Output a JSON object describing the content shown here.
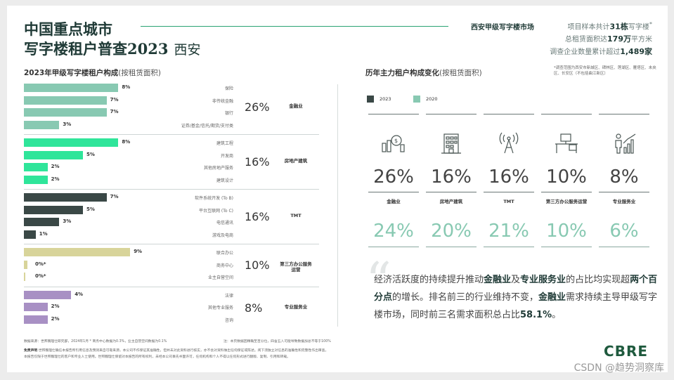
{
  "header": {
    "title_line1": "中国重点城市",
    "title_line2": "写字楼租户普查2023",
    "city": "西安",
    "market_label": "西安甲级写字楼市场",
    "stat1_pre": "项目样本共计",
    "stat1_val": "31栋",
    "stat1_post": "写字楼",
    "stat2_pre": "总租赁面积达",
    "stat2_val": "179万",
    "stat2_post": "平方米",
    "stat3_pre": "调查企业数量累计超过",
    "stat3_val": "1,489家",
    "footnote_mark": "*",
    "scope_note": "*调查范围为西安市新城区、碑林区、莲湖区、雁塔区、未央区、长安区（不包括曲江新区）"
  },
  "left": {
    "title": "2023年甲级写字楼租户构成",
    "title_sub": "(按租赁面积)"
  },
  "right": {
    "title": "历年主力租户构成变化",
    "title_sub": "(按租赁面积)",
    "legend": [
      {
        "label": "2023",
        "color": "#3a4846"
      },
      {
        "label": "2020",
        "color": "#88c9b2"
      }
    ]
  },
  "chart_data": [
    {
      "type": "bar",
      "orientation": "horizontal",
      "title": "2023年甲级写字楼租户构成(按租赁面积)",
      "groups": [
        {
          "name": "金融业",
          "total": "26%",
          "color": "#88c9b2",
          "items": [
            {
              "label": "保险",
              "value": 8
            },
            {
              "label": "非传统金融",
              "value": 7
            },
            {
              "label": "银行",
              "value": 7
            },
            {
              "label": "证券/基金/信托/期货/支付类",
              "value": 3
            }
          ]
        },
        {
          "name": "房地产建筑",
          "total": "16%",
          "color": "#2fe59a",
          "items": [
            {
              "label": "建筑工程",
              "value": 8
            },
            {
              "label": "开发商",
              "value": 5
            },
            {
              "label": "其他房地产服务",
              "value": 2
            },
            {
              "label": "建筑设计",
              "value": 2
            }
          ]
        },
        {
          "name": "TMT",
          "total": "16%",
          "color": "#3a4846",
          "items": [
            {
              "label": "软件系统开发 (To B)",
              "value": 7
            },
            {
              "label": "平台互联网 (To C)",
              "value": 5
            },
            {
              "label": "电信通讯",
              "value": 3
            },
            {
              "label": "游戏及电商",
              "value": 1
            }
          ]
        },
        {
          "name": "第三方办公服务运营",
          "total": "10%",
          "color": "#d8d49a",
          "items": [
            {
              "label": "联合办公",
              "value": 9
            },
            {
              "label": "商务中心",
              "value": 0.3,
              "display": "0%*"
            },
            {
              "label": "业主自营空间",
              "value": 0.1,
              "display": "0%*"
            }
          ]
        },
        {
          "name": "专业服务业",
          "total": "8%",
          "color": "#a890c4",
          "items": [
            {
              "label": "法律",
              "value": 4
            },
            {
              "label": "其他专业服务",
              "value": 2
            },
            {
              "label": "咨询",
              "value": 2
            }
          ]
        }
      ],
      "value_unit": "%"
    },
    {
      "type": "table",
      "title": "历年主力租户构成变化(按租赁面积)",
      "categories": [
        "金融业",
        "房地产建筑",
        "TMT",
        "第三方办公服务运营",
        "专业服务业"
      ],
      "icons": [
        "finance-icon",
        "building-icon",
        "tower-icon",
        "office-desk-icon",
        "professional-icon"
      ],
      "series": [
        {
          "name": "2023",
          "values": [
            "26%",
            "16%",
            "16%",
            "10%",
            "8%"
          ]
        },
        {
          "name": "2020",
          "values": [
            "24%",
            "20%",
            "21%",
            "10%",
            "6%"
          ]
        }
      ]
    }
  ],
  "commentary": {
    "p1": "经济活跃度的持续提升推动",
    "b1": "金融业",
    "p2": "及",
    "b2": "专业服务业",
    "p3": "的占比均实现超",
    "b3": "两个百分点",
    "p4": "的增长。排名前三的行业维持不变，",
    "b4": "金融业",
    "p5": "需求持续主导甲级写字楼市场，同时前三名需求面积总占比",
    "b5": "58.1%",
    "p6": "。"
  },
  "footer": {
    "source": "数据来源：世邦魏理仕研究部，2024年1月    * 商务中心数据为0.3%，业主自营空间数据为0.1%",
    "note": "注：本页数据因精确至百分位，四舍五入可能导致数据加总不等于100%",
    "disclaimer_label": "免责声明",
    "disclaimer": "世邦魏理仕确信本报告所引用信息及预测来自可靠来源，本公司不作保证其准确性，但并未对此资料进行核实，亦不会对资料做出任何保证或陈述。阅下须独立对信息的准确性和完整性作出审查。",
    "rights": "本报告仅限于世邦魏理仕的客户和专业人士使用。世邦魏理仕保留对本报告的所有权利，未经本公司事先书面许可，任何机构和个人不得以任何形式进行翻版、复制、引用和转载。"
  },
  "brand": {
    "logo": "CBRE"
  },
  "watermark": "CSDN @趋势洞察库"
}
